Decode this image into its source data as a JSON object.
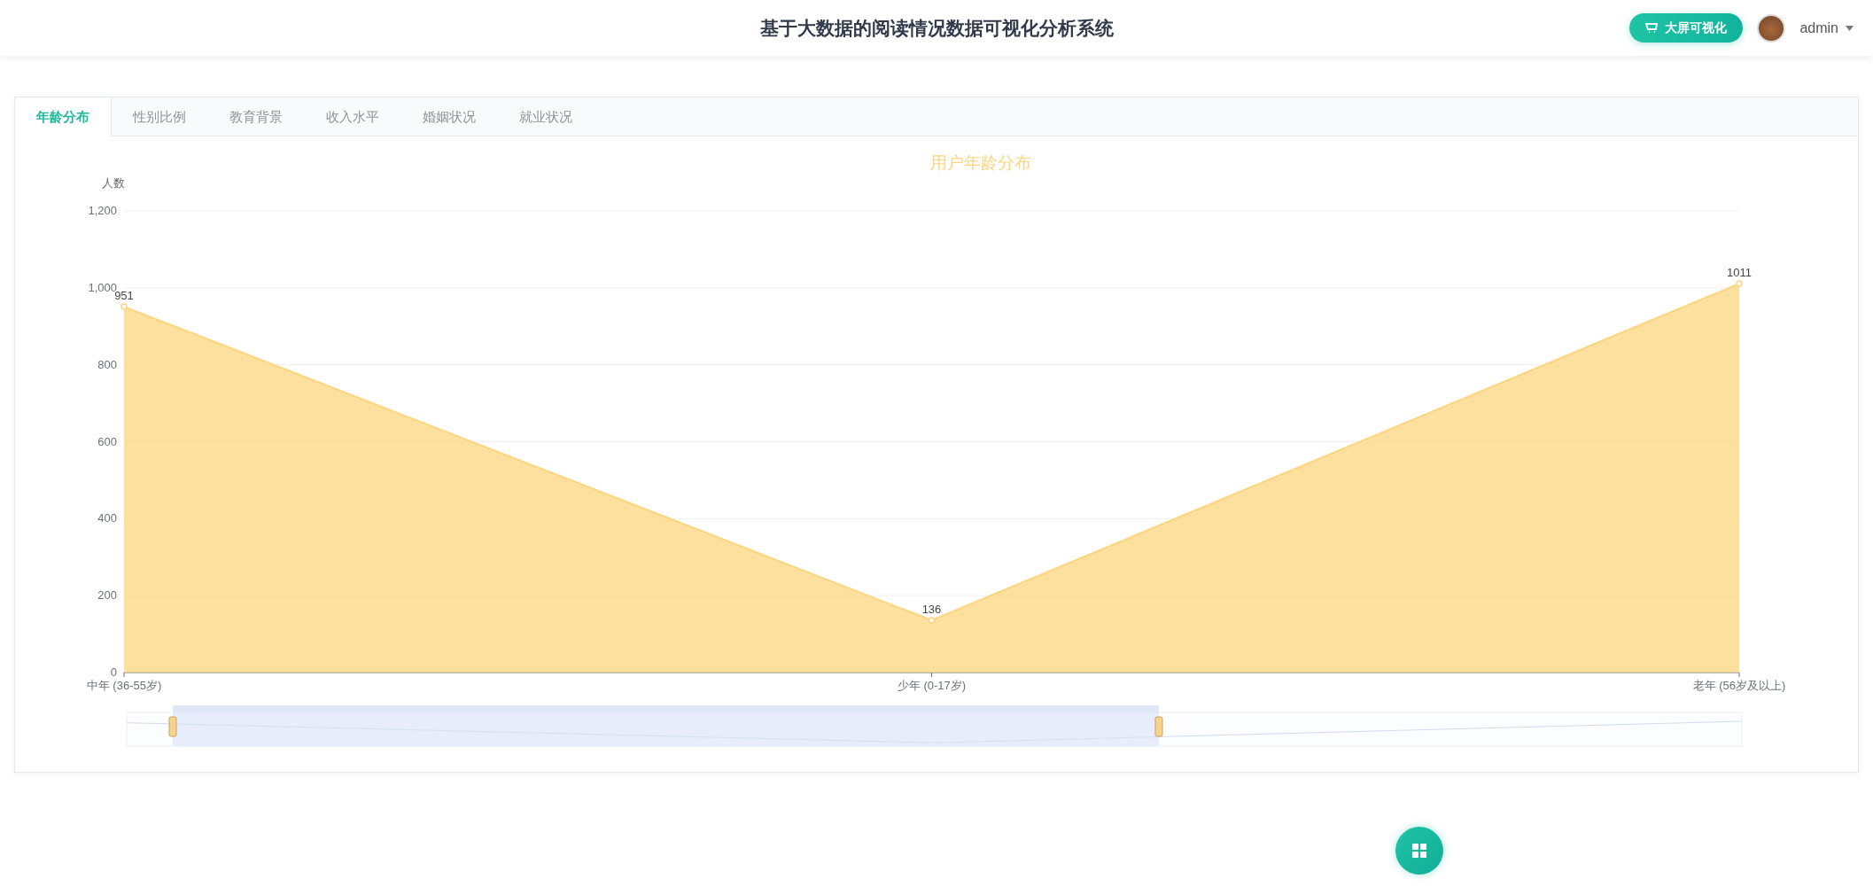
{
  "header": {
    "title": "基于大数据的阅读情况数据可视化分析系统",
    "screen_button": "大屏可视化",
    "user": "admin"
  },
  "tabs": [
    {
      "label": "年龄分布",
      "selected": true
    },
    {
      "label": "性别比例",
      "selected": false
    },
    {
      "label": "教育背景",
      "selected": false
    },
    {
      "label": "收入水平",
      "selected": false
    },
    {
      "label": "婚姻状况",
      "selected": false
    },
    {
      "label": "就业状况",
      "selected": false
    }
  ],
  "chart_data": {
    "type": "area",
    "title": "用户年龄分布",
    "ylabel": "人数",
    "categories": [
      "中年 (36-55岁)",
      "少年 (0-17岁)",
      "老年 (56岁及以上)"
    ],
    "series": [
      {
        "color": "#fcd57e",
        "values": [
          951,
          136,
          1011
        ]
      }
    ],
    "grid": true,
    "ylim": [
      0,
      1200
    ],
    "yticks": [
      0,
      200,
      400,
      600,
      800,
      {
        "value": 1000,
        "label": "1,000"
      },
      {
        "value": 1200,
        "label": "1,200"
      }
    ],
    "data_labels": true
  }
}
